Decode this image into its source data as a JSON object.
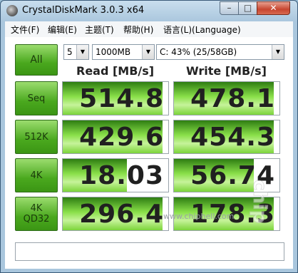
{
  "window": {
    "title": "CrystalDiskMark 3.0.3 x64"
  },
  "titlebar": {
    "minimize": "–",
    "maximize": "□",
    "close": "✕"
  },
  "menu": [
    "文件(F)",
    "编辑(E)",
    "主题(T)",
    "帮助(H)",
    "语言(L)(Language)"
  ],
  "controls": {
    "all_label": "All",
    "runs": "5",
    "size": "1000MB",
    "drive": "C: 43% (25/58GB)"
  },
  "columns": {
    "read": "Read [MB/s]",
    "write": "Write [MB/s]"
  },
  "rows": [
    {
      "label": "Seq",
      "label2": "",
      "read": "514.8",
      "write": "478.1"
    },
    {
      "label": "512K",
      "label2": "",
      "read": "429.6",
      "write": "454.3"
    },
    {
      "label": "4K",
      "label2": "",
      "read": "18.03",
      "write": "56.74"
    },
    {
      "label": "4K",
      "label2": "QD32",
      "read": "296.4",
      "write": "178.3"
    }
  ],
  "watermark": "www.chiphell.com",
  "watermark_logo": "chip hell",
  "colors": {
    "accent_green": "#4aa81e",
    "bar_green": "#8ae04a"
  }
}
